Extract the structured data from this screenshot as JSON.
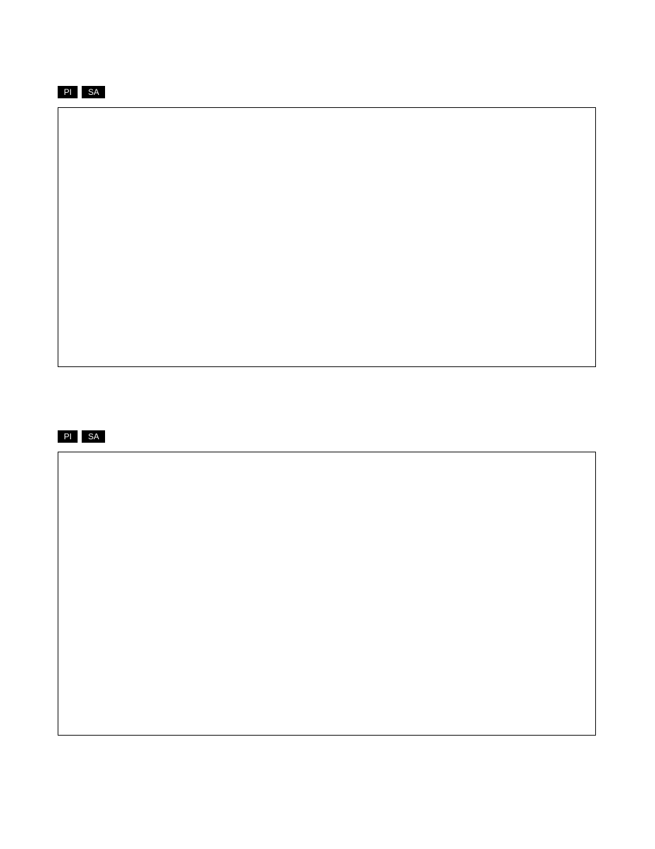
{
  "sections": [
    {
      "tags": [
        "PI",
        "SA"
      ]
    },
    {
      "tags": [
        "PI",
        "SA"
      ]
    }
  ]
}
